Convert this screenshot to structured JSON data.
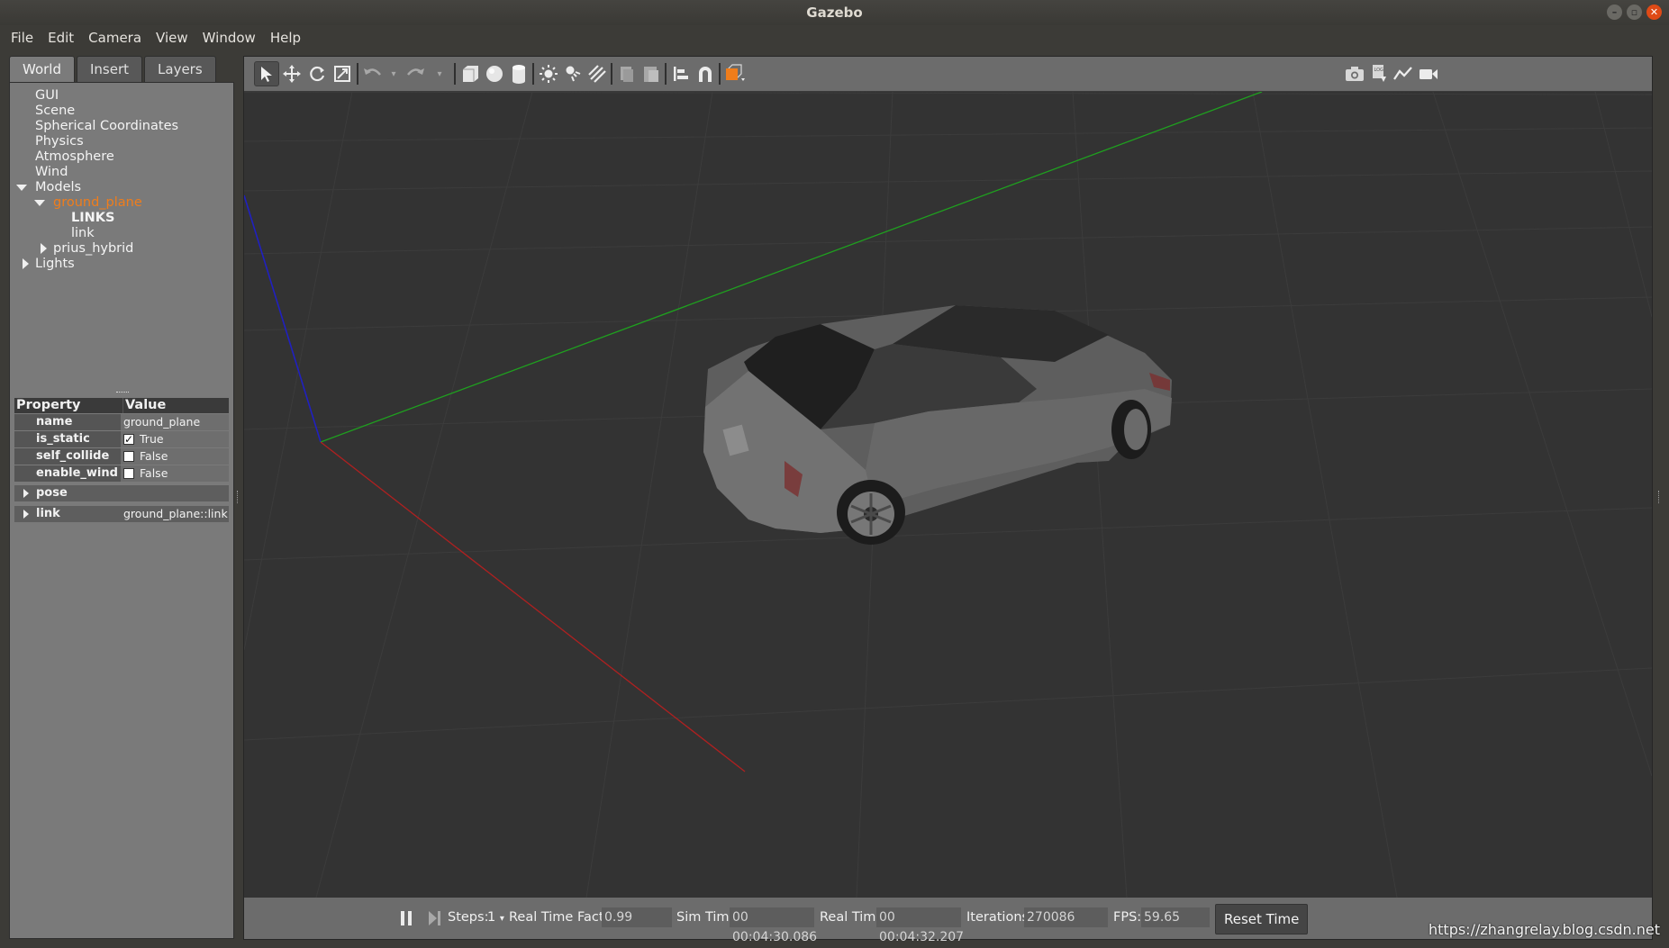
{
  "window": {
    "title": "Gazebo"
  },
  "menu": [
    "File",
    "Edit",
    "Camera",
    "View",
    "Window",
    "Help"
  ],
  "left_panel": {
    "tabs": [
      "World",
      "Insert",
      "Layers"
    ],
    "active_tab": "World",
    "tree": [
      {
        "label": "GUI"
      },
      {
        "label": "Scene"
      },
      {
        "label": "Spherical Coordinates"
      },
      {
        "label": "Physics"
      },
      {
        "label": "Atmosphere"
      },
      {
        "label": "Wind"
      },
      {
        "label": "Models"
      },
      {
        "label": "ground_plane"
      },
      {
        "label": "LINKS"
      },
      {
        "label": "link"
      },
      {
        "label": "prius_hybrid"
      },
      {
        "label": "Lights"
      }
    ],
    "properties": {
      "header_property": "Property",
      "header_value": "Value",
      "rows": [
        {
          "name": "name",
          "value": "ground_plane"
        },
        {
          "name": "is_static",
          "value": "True",
          "checked": true
        },
        {
          "name": "self_collide",
          "value": "False",
          "checked": false
        },
        {
          "name": "enable_wind",
          "value": "False",
          "checked": false
        },
        {
          "name": "pose",
          "value": ""
        },
        {
          "name": "link",
          "value": "ground_plane::link"
        }
      ]
    }
  },
  "toolbar": {
    "tools": [
      "select-icon",
      "translate-icon",
      "rotate-icon",
      "scale-icon",
      "undo-icon",
      "redo-icon",
      "box-icon",
      "sphere-icon",
      "cylinder-icon",
      "point-light-icon",
      "spot-light-icon",
      "directional-light-icon",
      "copy-icon",
      "paste-icon",
      "align-icon",
      "snap-icon",
      "view-angle-icon",
      "screenshot-icon",
      "log-icon",
      "plot-icon",
      "video-icon"
    ]
  },
  "bottom_bar": {
    "steps_label": "Steps:",
    "steps_value": "1",
    "rtf_label": "Real Time Factor:",
    "rtf_value": "0.99",
    "sim_time_label": "Sim Time:",
    "sim_time_value": "00 00:04:30.086",
    "real_time_label": "Real Time:",
    "real_time_value": "00 00:04:32.207",
    "iterations_label": "Iterations:",
    "iterations_value": "270086",
    "fps_label": "FPS:",
    "fps_value": "59.65",
    "reset_label": "Reset Time"
  },
  "watermark": "https://zhangrelay.blog.csdn.net",
  "colors": {
    "selected_item": "#f07d1b",
    "x_axis": "#b02020",
    "y_axis": "#1fa01f",
    "z_axis": "#2020c0",
    "close_button": "#df4a16"
  }
}
